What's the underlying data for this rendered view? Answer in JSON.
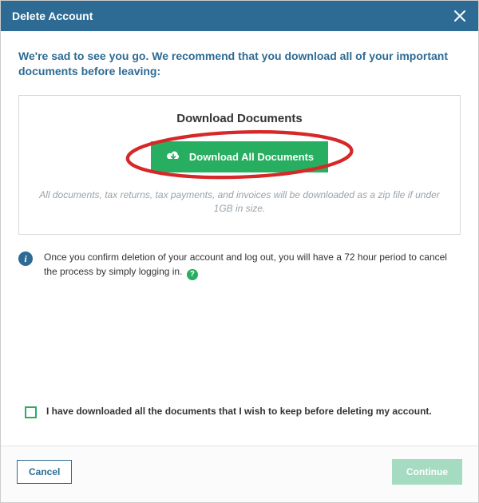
{
  "header": {
    "title": "Delete Account"
  },
  "intro": "We're sad to see you go. We recommend that you download all of your important documents before leaving:",
  "downloadPanel": {
    "title": "Download Documents",
    "buttonLabel": "Download All Documents",
    "note": "All documents, tax returns, tax payments, and invoices will be downloaded as a zip file if under 1GB in size."
  },
  "infoText": "Once you confirm deletion of your account and log out, you will have a 72 hour period to cancel the process by simply logging in.",
  "confirm": {
    "checked": false,
    "label": "I have downloaded all the documents that I wish to keep before deleting my account."
  },
  "footer": {
    "cancel": "Cancel",
    "continue": "Continue"
  },
  "colors": {
    "primary": "#2d6b94",
    "accent": "#27ae60",
    "annotation": "#d62828"
  }
}
